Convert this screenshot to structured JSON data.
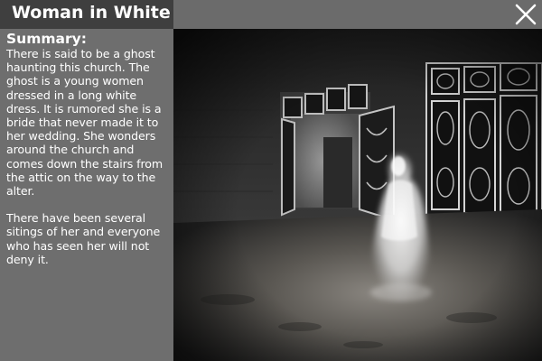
{
  "window": {
    "title": "Woman in White",
    "close_icon": "close-icon"
  },
  "sidebar": {
    "heading": "Summary:",
    "paragraphs": [
      "There is said to be a ghost haunting this church. The ghost is a young women dressed in a long white dress. It is rumored she is a bride that never made it to her wedding. She wonders around the church and comes down the stairs from the attic on the way to the alter.",
      "There have been several sitings of her and everyone who has seen her will not deny it."
    ]
  },
  "image": {
    "subject": "ghost-photo"
  },
  "colors": {
    "titlebar": "#6b6b6b",
    "title_tab": "#3f3f3f",
    "sidebar": "#6e6e6e",
    "text": "#ffffff"
  }
}
